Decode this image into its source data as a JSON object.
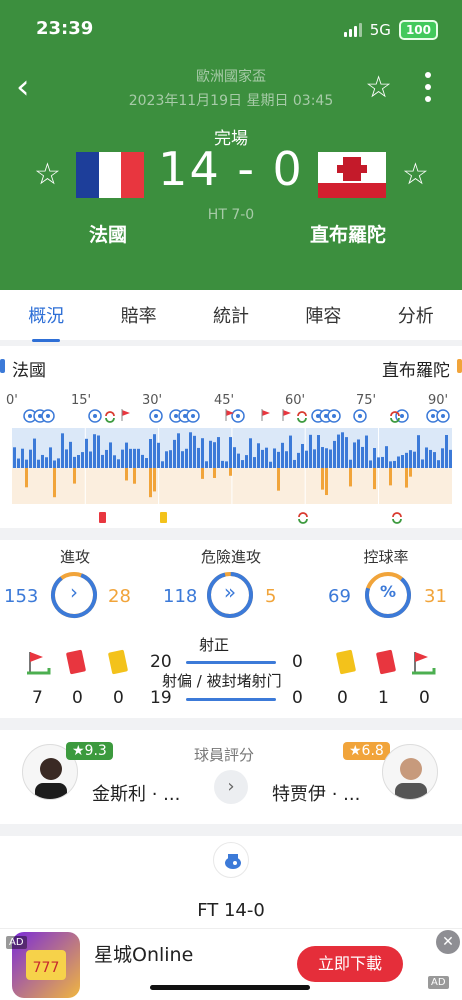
{
  "status_bar": {
    "time": "23:39",
    "network": "5G",
    "battery": "100"
  },
  "header": {
    "competition": "歐洲國家盃",
    "datetime": "2023年11月19日 星期日 03:45",
    "match_status": "完場",
    "score": "14 - 0",
    "halftime": "HT 7-0",
    "home_team": "法國",
    "away_team": "直布羅陀"
  },
  "tabs": [
    "概況",
    "賠率",
    "統計",
    "陣容",
    "分析"
  ],
  "timeline": {
    "home_label": "法國",
    "away_label": "直布羅陀",
    "minutes": [
      "0'",
      "15'",
      "30'",
      "45'",
      "60'",
      "75'",
      "90'"
    ],
    "home_color": "#3c7ad8",
    "away_color": "#f1a43a"
  },
  "stats": {
    "gauges": [
      {
        "label": "進攻",
        "home": "153",
        "away": "28",
        "icon": "chevron-right-icon",
        "glyph": "›"
      },
      {
        "label": "危險進攻",
        "home": "118",
        "away": "5",
        "icon": "triple-chevron-icon",
        "glyph": "»"
      },
      {
        "label": "控球率",
        "home": "69",
        "away": "31",
        "icon": "percent-icon",
        "glyph": "%"
      }
    ],
    "shots_on_label": "射正",
    "shots_on_home": "20",
    "shots_on_away": "0",
    "shots_off_label": "射偏 / 被封堵射门",
    "shots_off_home": "19",
    "shots_off_away": "0",
    "home_corners": "7",
    "home_red": "0",
    "home_yellow": "0",
    "away_yellow": "0",
    "away_red": "1",
    "away_corners": "0"
  },
  "ratings": {
    "title": "球員評分",
    "home_player": "金斯利 · ...",
    "home_rating": "★9.3",
    "away_player": "特贾伊 · ...",
    "away_rating": "★6.8"
  },
  "events": {
    "final": "FT 14-0"
  },
  "ad": {
    "tag": "AD",
    "title": "星城Online",
    "cta": "立即下載",
    "close": "✕",
    "corner_tag": "AD"
  }
}
